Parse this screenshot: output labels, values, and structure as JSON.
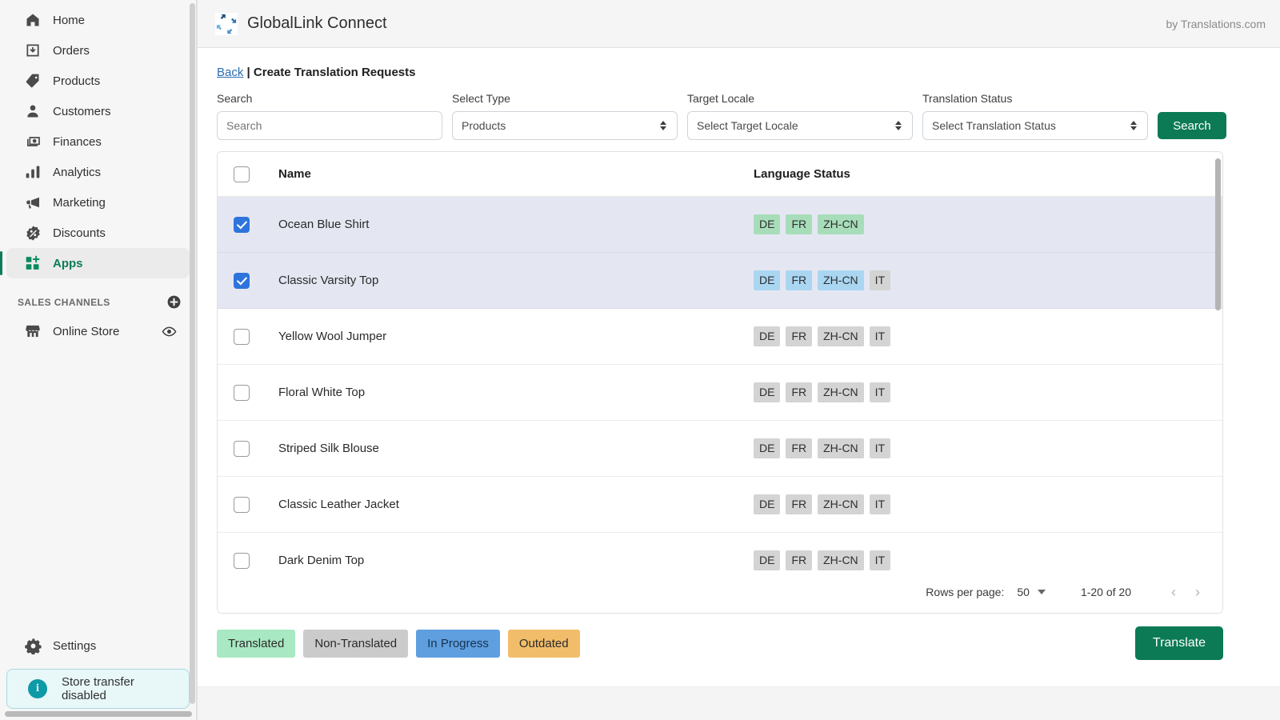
{
  "sidebar": {
    "items": [
      {
        "label": "Home",
        "icon": "home-icon",
        "active": false
      },
      {
        "label": "Orders",
        "icon": "orders-icon",
        "active": false
      },
      {
        "label": "Products",
        "icon": "products-icon",
        "active": false
      },
      {
        "label": "Customers",
        "icon": "customers-icon",
        "active": false
      },
      {
        "label": "Finances",
        "icon": "finances-icon",
        "active": false
      },
      {
        "label": "Analytics",
        "icon": "analytics-icon",
        "active": false
      },
      {
        "label": "Marketing",
        "icon": "marketing-icon",
        "active": false
      },
      {
        "label": "Discounts",
        "icon": "discounts-icon",
        "active": false
      },
      {
        "label": "Apps",
        "icon": "apps-icon",
        "active": true
      }
    ],
    "section_title": "SALES CHANNELS",
    "add_channel_icon": "plus-circle-icon",
    "channels": [
      {
        "label": "Online Store",
        "icon": "store-icon",
        "trailing_icon": "eye-icon"
      }
    ],
    "settings": {
      "label": "Settings",
      "icon": "gear-icon"
    },
    "alert": {
      "text": "Store transfer disabled",
      "icon": "info-icon",
      "accent": "#0e9aa7"
    }
  },
  "header": {
    "app_title": "GlobalLink Connect",
    "logo_icon": "globallink-logo-icon",
    "byline": "by Translations.com"
  },
  "breadcrumb": {
    "back_label": "Back",
    "separator": "|",
    "page_title": "Create Translation Requests"
  },
  "filters": {
    "search": {
      "label": "Search",
      "placeholder": "Search",
      "value": ""
    },
    "type": {
      "label": "Select Type",
      "value": "Products"
    },
    "locale": {
      "label": "Target Locale",
      "value": "Select Target Locale"
    },
    "status": {
      "label": "Translation Status",
      "value": "Select Translation Status"
    },
    "search_button": "Search"
  },
  "table": {
    "columns": {
      "name": "Name",
      "language_status": "Language Status"
    },
    "select_all_checked": false,
    "rows": [
      {
        "name": "Ocean Blue Shirt",
        "checked": true,
        "badges": [
          {
            "code": "DE",
            "state": "translated"
          },
          {
            "code": "FR",
            "state": "translated"
          },
          {
            "code": "ZH-CN",
            "state": "translated"
          }
        ]
      },
      {
        "name": "Classic Varsity Top",
        "checked": true,
        "badges": [
          {
            "code": "DE",
            "state": "inprogress"
          },
          {
            "code": "FR",
            "state": "inprogress"
          },
          {
            "code": "ZH-CN",
            "state": "inprogress"
          },
          {
            "code": "IT",
            "state": "nontranslated"
          }
        ]
      },
      {
        "name": "Yellow Wool Jumper",
        "checked": false,
        "badges": [
          {
            "code": "DE",
            "state": "nontranslated"
          },
          {
            "code": "FR",
            "state": "nontranslated"
          },
          {
            "code": "ZH-CN",
            "state": "nontranslated"
          },
          {
            "code": "IT",
            "state": "nontranslated"
          }
        ]
      },
      {
        "name": "Floral White Top",
        "checked": false,
        "badges": [
          {
            "code": "DE",
            "state": "nontranslated"
          },
          {
            "code": "FR",
            "state": "nontranslated"
          },
          {
            "code": "ZH-CN",
            "state": "nontranslated"
          },
          {
            "code": "IT",
            "state": "nontranslated"
          }
        ]
      },
      {
        "name": "Striped Silk Blouse",
        "checked": false,
        "badges": [
          {
            "code": "DE",
            "state": "nontranslated"
          },
          {
            "code": "FR",
            "state": "nontranslated"
          },
          {
            "code": "ZH-CN",
            "state": "nontranslated"
          },
          {
            "code": "IT",
            "state": "nontranslated"
          }
        ]
      },
      {
        "name": "Classic Leather Jacket",
        "checked": false,
        "badges": [
          {
            "code": "DE",
            "state": "nontranslated"
          },
          {
            "code": "FR",
            "state": "nontranslated"
          },
          {
            "code": "ZH-CN",
            "state": "nontranslated"
          },
          {
            "code": "IT",
            "state": "nontranslated"
          }
        ]
      },
      {
        "name": "Dark Denim Top",
        "checked": false,
        "badges": [
          {
            "code": "DE",
            "state": "nontranslated"
          },
          {
            "code": "FR",
            "state": "nontranslated"
          },
          {
            "code": "ZH-CN",
            "state": "nontranslated"
          },
          {
            "code": "IT",
            "state": "nontranslated"
          }
        ]
      }
    ],
    "footer": {
      "rows_per_page_label": "Rows per page:",
      "rows_per_page_value": "50",
      "range": "1-20 of 20",
      "prev_icon": "chevron-left-icon",
      "next_icon": "chevron-right-icon"
    }
  },
  "legend": [
    {
      "label": "Translated",
      "state": "translated",
      "color": "#a8e8c2"
    },
    {
      "label": "Non-Translated",
      "state": "nontranslated",
      "color": "#cbcbcb"
    },
    {
      "label": "In Progress",
      "state": "inprogress",
      "color": "#5f9fe0"
    },
    {
      "label": "Outdated",
      "state": "outdated",
      "color": "#f2bd6a"
    }
  ],
  "primary_action": {
    "label": "Translate",
    "color": "#0b7a55"
  }
}
